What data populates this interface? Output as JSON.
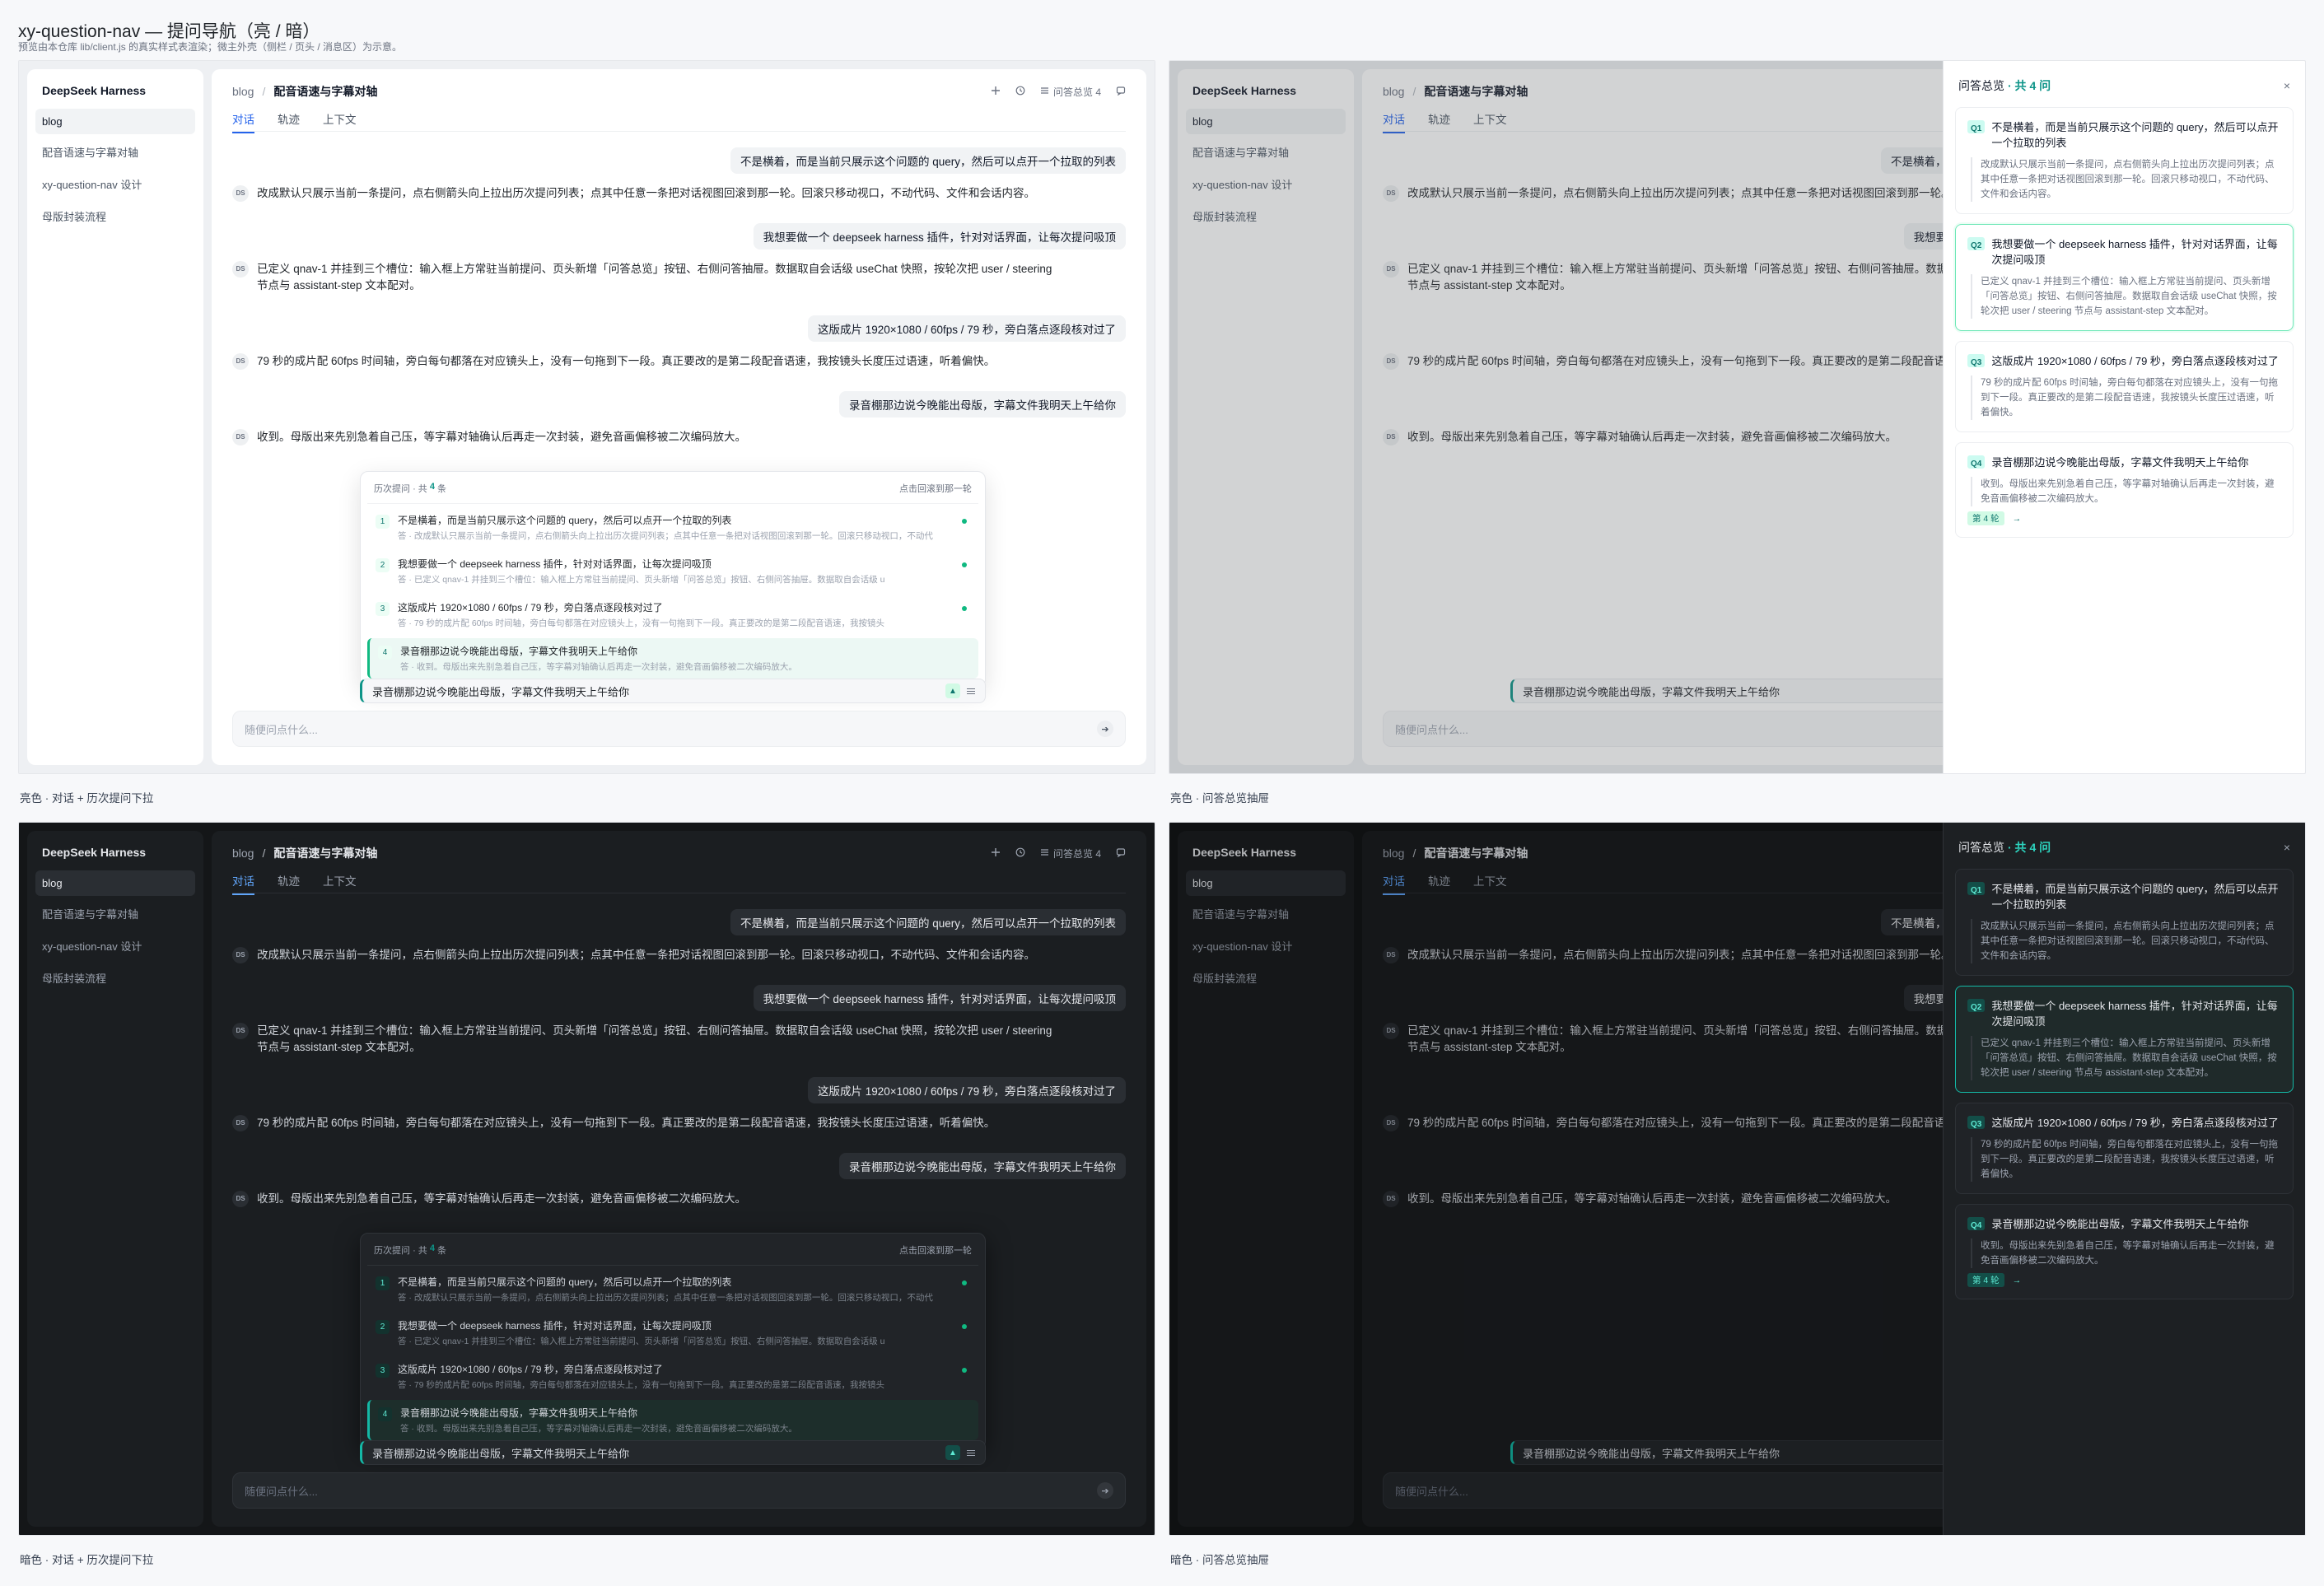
{
  "header": {
    "title": "xy-question-nav — 提问导航（亮 / 暗）",
    "subtitle": "预览由本仓库 lib/client.js 的真实样式表渲染；微主外壳（侧栏 / 页头 / 消息区）为示意。"
  },
  "panel_labels": {
    "light_chat": "亮色 · 对话 + 历次提问下拉",
    "light_drawer": "亮色 · 问答总览抽屉",
    "dark_chat": "暗色 · 对话 + 历次提问下拉",
    "dark_drawer": "暗色 · 问答总览抽屉"
  },
  "sidebar": {
    "brand": "DeepSeek Harness",
    "items": [
      "blog",
      "配音语速与字幕对轴",
      "xy-question-nav 设计",
      "母版封装流程"
    ]
  },
  "topbar": {
    "crumb_root": "blog",
    "crumb_sep": "/",
    "crumb_current": "配音语速与字幕对轴",
    "overview_label": "问答总览 4",
    "icons": [
      "plus-icon",
      "clock-icon",
      "list-icon",
      "chat-icon"
    ]
  },
  "tabs": [
    "对话",
    "轨迹",
    "上下文"
  ],
  "messages": [
    {
      "role": "user",
      "text": "不是横着，而是当前只展示这个问题的 query，然后可以点开一个拉取的列表"
    },
    {
      "role": "assistant",
      "avatar": "DS",
      "text": "改成默认只展示当前一条提问，点右侧箭头向上拉出历次提问列表；点其中任意一条把对话视图回滚到那一轮。回滚只移动视口，不动代码、文件和会话内容。"
    },
    {
      "role": "user",
      "text": "我想要做一个 deepseek harness 插件，针对对话界面，让每次提问吸顶"
    },
    {
      "role": "assistant",
      "avatar": "DS",
      "text": "已定义 qnav-1 并挂到三个槽位：输入框上方常驻当前提问、页头新增「问答总览」按钮、右侧问答抽屉。数据取自会话级 useChat 快照，按轮次把 user / steering 节点与 assistant-step 文本配对。"
    },
    {
      "role": "user",
      "text": "这版成片 1920×1080 / 60fps / 79 秒，旁白落点逐段核对过了"
    },
    {
      "role": "assistant",
      "avatar": "DS",
      "text": "79 秒的成片配 60fps 时间轴，旁白每句都落在对应镜头上，没有一句拖到下一段。真正要改的是第二段配音语速，我按镜头长度压过语速，听着偏快。"
    },
    {
      "role": "user",
      "text": "录音棚那边说今晚能出母版，字幕文件我明天上午给你"
    },
    {
      "role": "assistant",
      "avatar": "DS",
      "text": "收到。母版出来先别急着自己压，等字幕对轴确认后再走一次封装，避免音画偏移被二次编码放大。"
    }
  ],
  "history": {
    "title": "历次提问",
    "count_prefix": "· 共",
    "count": "4",
    "count_suffix": "条",
    "hint": "点击回滚到那一轮",
    "items": [
      {
        "n": "1",
        "q": "不是横着，而是当前只展示这个问题的 query，然后可以点开一个拉取的列表",
        "a": "答 · 改成默认只展示当前一条提问，点右侧箭头向上拉出历次提问列表；点其中任意一条把对话视图回滚到那一轮。回滚只移动视口，不动代"
      },
      {
        "n": "2",
        "q": "我想要做一个 deepseek harness 插件，针对对话界面，让每次提问吸顶",
        "a": "答 · 已定义 qnav-1 并挂到三个槽位：输入框上方常驻当前提问、页头新增「问答总览」按钮、右侧问答抽屉。数据取自会话级 u"
      },
      {
        "n": "3",
        "q": "这版成片 1920×1080 / 60fps / 79 秒，旁白落点逐段核对过了",
        "a": "答 · 79 秒的成片配 60fps 时间轴，旁白每句都落在对应镜头上，没有一句拖到下一段。真正要改的是第二段配音语速，我按镜头"
      },
      {
        "n": "4",
        "q": "录音棚那边说今晚能出母版，字幕文件我明天上午给你",
        "a": "答 · 收到。母版出来先别急着自己压，等字幕对轴确认后再走一次封装，避免音画偏移被二次编码放大。"
      }
    ]
  },
  "sticky_question": "录音棚那边说今晚能出母版，字幕文件我明天上午给你",
  "input": {
    "placeholder": "随便问点什么..."
  },
  "drawer": {
    "title": "问答总览",
    "count_text": "· 共 4 问",
    "close": "×",
    "turn_label": "第 4 轮",
    "turn_arrow": "→",
    "cards": [
      {
        "tag": "Q1",
        "q": "不是横着，而是当前只展示这个问题的 query，然后可以点开一个拉取的列表",
        "a": "改成默认只展示当前一条提问，点右侧箭头向上拉出历次提问列表；点其中任意一条把对话视图回滚到那一轮。回滚只移动视口，不动代码、文件和会话内容。"
      },
      {
        "tag": "Q2",
        "q": "我想要做一个 deepseek harness 插件，针对对话界面，让每次提问吸顶",
        "a": "已定义 qnav-1 并挂到三个槽位：输入框上方常驻当前提问、页头新增「问答总览」按钮、右侧问答抽屉。数据取自会话级 useChat 快照，按轮次把 user / steering 节点与 assistant-step 文本配对。"
      },
      {
        "tag": "Q3",
        "q": "这版成片 1920×1080 / 60fps / 79 秒，旁白落点逐段核对过了",
        "a": "79 秒的成片配 60fps 时间轴，旁白每句都落在对应镜头上，没有一句拖到下一段。真正要改的是第二段配音语速，我按镜头长度压过语速，听着偏快。"
      },
      {
        "tag": "Q4",
        "q": "录音棚那边说今晚能出母版，字幕文件我明天上午给你",
        "a": "收到。母版出来先别急着自己压，等字幕对轴确认后再走一次封装，避免音画偏移被二次编码放大。"
      }
    ]
  },
  "colors": {
    "accent": "#0d9488",
    "link": "#2563eb",
    "dot": "#10b981"
  }
}
